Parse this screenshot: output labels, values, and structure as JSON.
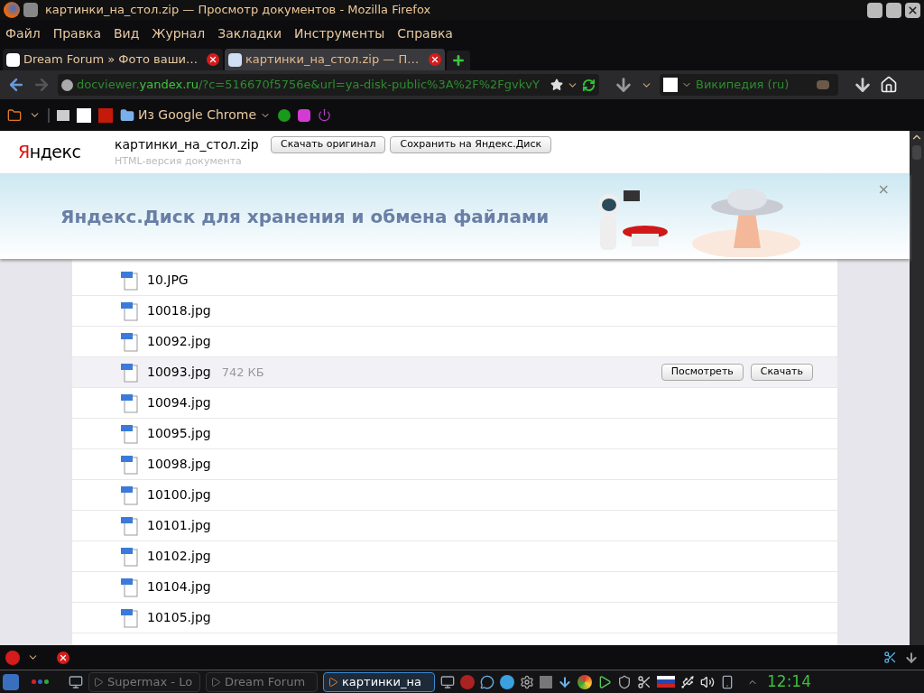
{
  "window": {
    "title": "картинки_на_стол.zip — Просмотр документов - Mozilla Firefox"
  },
  "menu": [
    "Файл",
    "Правка",
    "Вид",
    "Журнал",
    "Закладки",
    "Инструменты",
    "Справка"
  ],
  "tabs": [
    {
      "label": "Dream Forum » Фото ваши…",
      "selected": false
    },
    {
      "label": "картинки_на_стол.zip — П…",
      "selected": true
    }
  ],
  "address": {
    "prefix": "docviewer.",
    "domain": "yandex.ru",
    "rest": "/?c=516670f5756e&url=ya-disk-public%3A%2F%2FgvkvY"
  },
  "search": {
    "placeholder": "Википедия (ru)"
  },
  "bookmarks": [
    {
      "label": "Из Google Chrome"
    }
  ],
  "page": {
    "logo": {
      "first": "Я",
      "rest": "ндекс"
    },
    "doc_title": "картинки_на_стол.zip",
    "doc_subtitle": "HTML-версия документа",
    "buttons": [
      "Скачать оригинал",
      "Сохранить на Яндекс.Диск"
    ],
    "banner": {
      "text": "Яндекс.Диск для хранения и обмена файлами",
      "close": "×"
    },
    "files": [
      {
        "name": "10.JPG",
        "selected": false
      },
      {
        "name": "10018.jpg",
        "selected": false
      },
      {
        "name": "10092.jpg",
        "selected": false
      },
      {
        "name": "10093.jpg",
        "selected": true,
        "size": "742 КБ",
        "actions": [
          "Посмотреть",
          "Скачать"
        ]
      },
      {
        "name": "10094.jpg",
        "selected": false
      },
      {
        "name": "10095.jpg",
        "selected": false
      },
      {
        "name": "10098.jpg",
        "selected": false
      },
      {
        "name": "10100.jpg",
        "selected": false
      },
      {
        "name": "10101.jpg",
        "selected": false
      },
      {
        "name": "10102.jpg",
        "selected": false
      },
      {
        "name": "10104.jpg",
        "selected": false
      },
      {
        "name": "10105.jpg",
        "selected": false
      }
    ]
  },
  "taskbar": {
    "tasks": [
      {
        "label": "Supermax - Lo",
        "selected": false
      },
      {
        "label": "Dream Forum",
        "selected": false
      },
      {
        "label": "картинки_на",
        "selected": true
      }
    ],
    "clock": "12:14"
  }
}
